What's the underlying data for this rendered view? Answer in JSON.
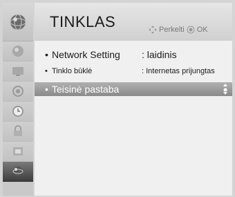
{
  "header": {
    "title": "TINKLAS",
    "hint_move": "Perkelti",
    "hint_ok": "OK"
  },
  "menu": {
    "items": [
      {
        "bullet": "•",
        "label": "Network Setting",
        "value": ": laidinis"
      },
      {
        "bullet": "•",
        "label": "Tinklo būklė",
        "value": ": Internetas prijungtas"
      },
      {
        "bullet": "•",
        "label": "Teisinė pastaba"
      }
    ]
  },
  "sidebar": {
    "items": [
      "picture-icon",
      "screen-icon",
      "audio-icon",
      "clock-icon",
      "lock-icon",
      "option-icon",
      "network-icon"
    ],
    "active": "network-icon"
  },
  "colors": {
    "highlight": "#9a9a9a",
    "panel": "#f0f0f0"
  }
}
